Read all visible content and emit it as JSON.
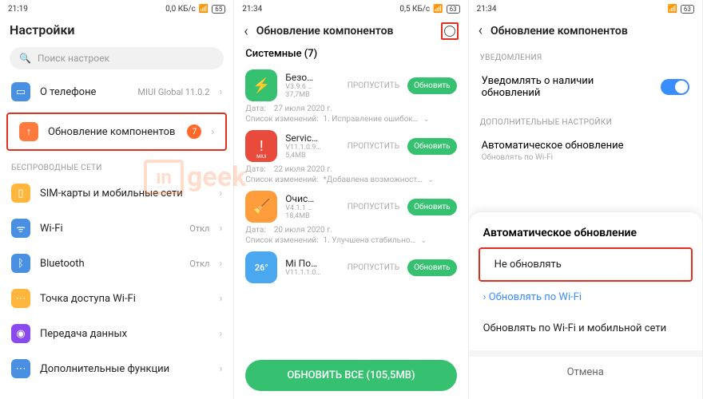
{
  "panel1": {
    "status": {
      "time": "21:19",
      "speed": "0,0 КБ/с",
      "battery": "65"
    },
    "title": "Настройки",
    "search_placeholder": "Поиск настроек",
    "about": {
      "label": "О телефоне",
      "value": "MIUI Global 11.0.2"
    },
    "update_row": {
      "label": "Обновление компонентов",
      "badge": "7"
    },
    "section_wireless": "БЕСПРОВОДНЫЕ СЕТИ",
    "rows": {
      "sim": "SIM-карты и мобильные сети",
      "wifi": {
        "label": "Wi-Fi",
        "value": "Откл"
      },
      "bt": {
        "label": "Bluetooth",
        "value": "Откл"
      },
      "hotspot": "Точка доступа Wi-Fi",
      "data": "Передача данных",
      "more": "Дополнительные функции"
    }
  },
  "panel2": {
    "status": {
      "time": "21:34",
      "speed": "0,5 КБ/с",
      "battery": "63"
    },
    "title": "Обновление компонентов",
    "subhead": "Системные (7)",
    "skip_label": "ПРОПУСТИТЬ",
    "update_label": "Обновить",
    "date_label": "Дата:",
    "changelog_label": "Список изменений:",
    "apps": [
      {
        "name": "Безо…",
        "ver": "V3.9.6 …",
        "size": "37,7МВ",
        "date": "27 июля 2020 г.",
        "log": "1. Исправление ошибок…"
      },
      {
        "name": "Servic…",
        "ver": "V11.1.0.9…",
        "size": "5,4МВ",
        "date": "22 июля 2020 г.",
        "log": "*Добавлена возможност…"
      },
      {
        "name": "Очис…",
        "ver": "V4.1.1 …",
        "size": "18,4МВ",
        "date": "20 июля 2020 г.",
        "log": "1. Улучшена стабильно…"
      },
      {
        "name": "Mi По…",
        "ver": "V11.1.1.0…",
        "size": "",
        "date": "",
        "log": ""
      }
    ],
    "temp_badge": "26°",
    "update_all": "ОБНОВИТЬ ВСЕ (105,5МВ)"
  },
  "panel3": {
    "status": {
      "time": "21:34",
      "speed": "",
      "battery": "63"
    },
    "title": "Обновление компонентов",
    "section_notif": "УВЕДОМЛЕНИЯ",
    "notif_row": "Уведомлять о наличии обновлений",
    "section_extra": "ДОПОЛНИТЕЛЬНЫЕ НАСТРОЙКИ",
    "auto_row": {
      "label": "Автоматическое обновление",
      "sub": "Обновлять по Wi-Fi"
    },
    "sheet": {
      "title": "Автоматическое обновление",
      "opt1": "Не обновлять",
      "opt2": "Обновлять по Wi-Fi",
      "opt3": "Обновлять по Wi-Fi и мобильной сети",
      "cancel": "Отмена"
    }
  },
  "watermark": "geek"
}
